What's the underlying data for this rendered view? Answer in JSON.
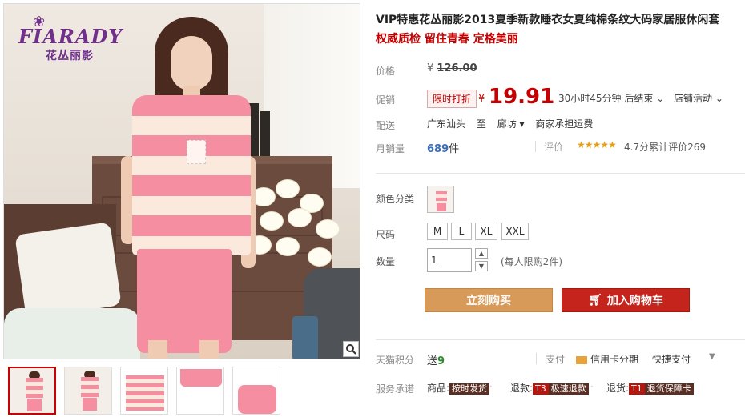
{
  "brand": {
    "wordmark": "FIARADY",
    "name_cn": "花丛丽影"
  },
  "gallery": {
    "thumb_count": 5,
    "active_index": 0
  },
  "product": {
    "title": "VIP特惠花丛丽影2013夏季新款睡衣女夏纯棉条纹大码家居服休闲套",
    "subtitle": "权威质检 留住青春 定格美丽"
  },
  "price": {
    "label": "价格",
    "currency": "¥",
    "original": "126.00"
  },
  "promo": {
    "label": "促销",
    "badge": "限时打折",
    "currency": "¥",
    "price": "19.91",
    "countdown": "30小时45分钟 后结束",
    "store_activity": "店铺活动"
  },
  "shipping": {
    "label": "配送",
    "from": "广东汕头",
    "to_word": "至",
    "dest": "廊坊",
    "fee": "商家承担运费"
  },
  "sales": {
    "label": "月销量",
    "count": "689",
    "unit": "件",
    "review_label": "评价",
    "stars": "★★★★★",
    "rating_text": "4.7分累计评价269"
  },
  "options": {
    "color_label": "颜色分类",
    "size_label": "尺码",
    "sizes": [
      "M",
      "L",
      "XL",
      "XXL"
    ],
    "qty_label": "数量",
    "qty_value": "1",
    "qty_note": "(每人限购2件)"
  },
  "actions": {
    "buy_now": "立刻购买",
    "add_cart": "加入购物车"
  },
  "points": {
    "label": "天猫积分",
    "prefix": "送",
    "value": "9"
  },
  "payment": {
    "label": "支付",
    "card": "信用卡分期",
    "quick": "快捷支付"
  },
  "service": {
    "label": "服务承诺",
    "items": [
      {
        "prefix": "商品:",
        "tag": "按时发货"
      },
      {
        "prefix": "退款:",
        "tag": "T3",
        "tag2": "极速退款"
      },
      {
        "prefix": "退货:",
        "tag": "T1",
        "tag2": "退货保障卡"
      }
    ]
  },
  "colors": {
    "accent": "#c40000",
    "buy": "#d89a59",
    "cart": "#c5241d",
    "stripe": "#f58ea0"
  }
}
